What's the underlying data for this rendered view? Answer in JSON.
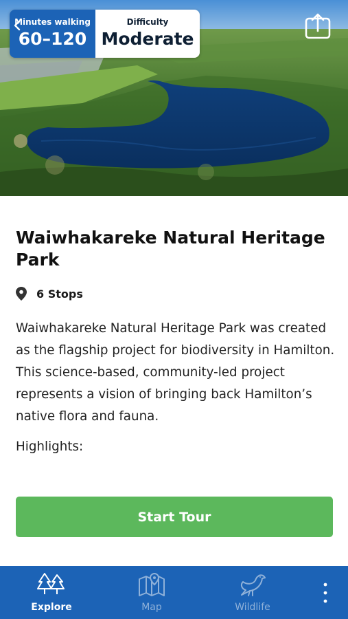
{
  "hero": {
    "walking": {
      "label": "Minutes walking",
      "value": "60–120"
    },
    "difficulty": {
      "label": "Difficulty",
      "value": "Moderate"
    },
    "icons": {
      "back": "back-chevron-icon",
      "share": "share-icon"
    }
  },
  "park": {
    "title": "Waiwhakareke Natural Heritage Park",
    "stops": "6 Stops",
    "stops_icon": "map-pin-icon",
    "description": "Waiwhakareke Natural Heritage Park was created as the flagship project for biodiversity in Hamilton. This science-based, community-led project represents a vision of bringing back Hamilton’s native flora and fauna.",
    "highlights_label": "Highlights:"
  },
  "actions": {
    "start_tour": "Start Tour"
  },
  "nav": {
    "items": [
      {
        "label": "Explore",
        "icon": "trees-icon",
        "active": true
      },
      {
        "label": "Map",
        "icon": "map-icon",
        "active": false
      },
      {
        "label": "Wildlife",
        "icon": "bird-icon",
        "active": false
      }
    ],
    "more_icon": "more-vertical-icon"
  },
  "colors": {
    "brand_blue": "#1c63b6",
    "button_green": "#5cb85c",
    "inactive_nav": "#8fb1d9"
  }
}
